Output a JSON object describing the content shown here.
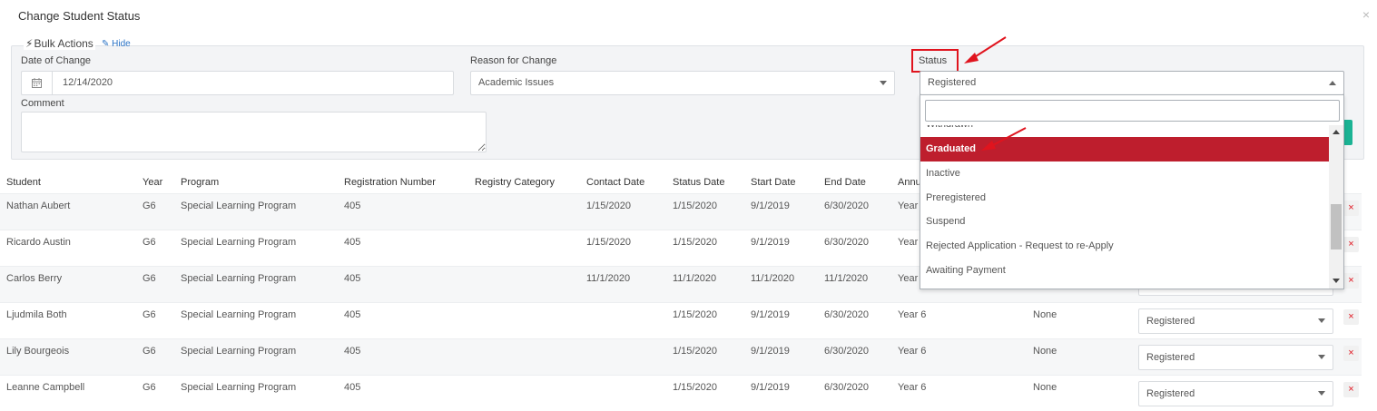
{
  "modal": {
    "title": "Change Student Status",
    "close": "×"
  },
  "bulk": {
    "legend": "Bulk Actions",
    "hide": "Hide",
    "date_label": "Date of Change",
    "date_value": "12/14/2020",
    "reason_label": "Reason for Change",
    "reason_value": "Academic Issues",
    "status_label": "Status",
    "status_value": "Registered",
    "comment_label": "Comment"
  },
  "dropdown": {
    "partial_item": "Withdrawn",
    "items": [
      "Graduated",
      "Inactive",
      "Preregistered",
      "Suspend",
      "Rejected Application - Request to re-Apply",
      "Awaiting Payment"
    ],
    "selected": "Graduated"
  },
  "table": {
    "headers": [
      "Student",
      "Year",
      "Program",
      "Registration Number",
      "Registry Category",
      "Contact Date",
      "Status Date",
      "Start Date",
      "End Date",
      "Annu"
    ],
    "rows": [
      {
        "student": "Nathan Aubert",
        "year": "G6",
        "program": "Special Learning Program",
        "reg": "405",
        "contact": "1/15/2020",
        "status_date": "1/15/2020",
        "start": "9/1/2019",
        "end": "6/30/2020",
        "annual": "Year",
        "category": "",
        "status": ""
      },
      {
        "student": "Ricardo Austin",
        "year": "G6",
        "program": "Special Learning Program",
        "reg": "405",
        "contact": "1/15/2020",
        "status_date": "1/15/2020",
        "start": "9/1/2019",
        "end": "6/30/2020",
        "annual": "Year",
        "category": "",
        "status": ""
      },
      {
        "student": "Carlos Berry",
        "year": "G6",
        "program": "Special Learning Program",
        "reg": "405",
        "contact": "11/1/2020",
        "status_date": "11/1/2020",
        "start": "11/1/2020",
        "end": "11/1/2020",
        "annual": "Year",
        "category": "",
        "status": ""
      },
      {
        "student": "Ljudmila Both",
        "year": "G6",
        "program": "Special Learning Program",
        "reg": "405",
        "contact": "",
        "status_date": "1/15/2020",
        "start": "9/1/2019",
        "end": "6/30/2020",
        "annual": "Year 6",
        "category": "None",
        "status": "Registered"
      },
      {
        "student": "Lily Bourgeois",
        "year": "G6",
        "program": "Special Learning Program",
        "reg": "405",
        "contact": "",
        "status_date": "1/15/2020",
        "start": "9/1/2019",
        "end": "6/30/2020",
        "annual": "Year 6",
        "category": "None",
        "status": "Registered"
      },
      {
        "student": "Leanne Campbell",
        "year": "G6",
        "program": "Special Learning Program",
        "reg": "405",
        "contact": "",
        "status_date": "1/15/2020",
        "start": "9/1/2019",
        "end": "6/30/2020",
        "annual": "Year 6",
        "category": "None",
        "status": "Registered"
      }
    ],
    "delete_glyph": "×"
  },
  "colors": {
    "highlight": "#e0141e",
    "selected_item": "#be1e2d",
    "link": "#2a73c6",
    "teal": "#1bb394"
  }
}
